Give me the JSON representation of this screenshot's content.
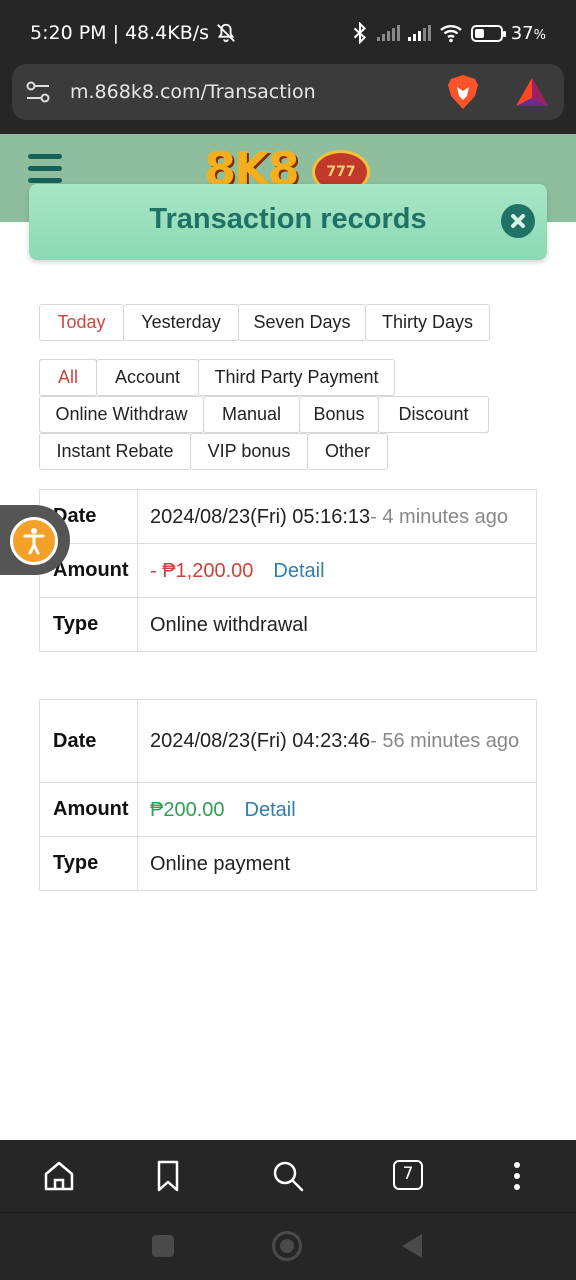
{
  "status_bar": {
    "time": "5:20 PM",
    "separator": "|",
    "speed": "48.4KB/s",
    "battery": "37",
    "battery_unit": "%",
    "battery_level": 0.37
  },
  "browser": {
    "url": "m.868k8.com/Transaction",
    "tab_count": "7"
  },
  "site": {
    "logo_text": "8K8",
    "logo_sub": "777"
  },
  "modal": {
    "title": "Transaction records"
  },
  "period_tabs": [
    {
      "label": "Today",
      "active": true
    },
    {
      "label": "Yesterday",
      "active": false
    },
    {
      "label": "Seven Days",
      "active": false
    },
    {
      "label": "Thirty Days",
      "active": false
    }
  ],
  "type_tabs": [
    {
      "label": "All",
      "active": true
    },
    {
      "label": "Account",
      "active": false
    },
    {
      "label": "Third Party Payment",
      "active": false
    },
    {
      "label": "Online Withdraw",
      "active": false
    },
    {
      "label": "Manual",
      "active": false
    },
    {
      "label": "Bonus",
      "active": false
    },
    {
      "label": "Discount",
      "active": false
    },
    {
      "label": "Instant Rebate",
      "active": false
    },
    {
      "label": "VIP bonus",
      "active": false
    },
    {
      "label": "Other",
      "active": false
    }
  ],
  "labels": {
    "date": "Date",
    "amount": "Amount",
    "type": "Type",
    "detail": "Detail"
  },
  "records": [
    {
      "date": "2024/08/23(Fri) 05:16:13",
      "ago": "- 4 minutes ago",
      "amount": "- ₱1,200.00",
      "type": "Online withdrawal",
      "direction": "negative"
    },
    {
      "date": "2024/08/23(Fri) 04:23:46",
      "ago": "- 56 minutes ago",
      "amount": "₱200.00",
      "type": "Online payment",
      "direction": "positive"
    }
  ],
  "colors": {
    "header_bg": "#8fbe9e",
    "modal_title": "#1f7265",
    "active_tab": "#d2453f",
    "negative": "#c9423c",
    "positive": "#2f9e58",
    "link": "#2f7fb2",
    "accessibility_button": "#f4a12a"
  },
  "icons": {
    "status_left": [
      "do-not-disturb-icon"
    ],
    "status_right": [
      "bluetooth-icon",
      "signal-icon",
      "signal-icon",
      "wifi-icon",
      "battery-icon"
    ],
    "browser": [
      "site-settings-icon",
      "brave-shield-icon",
      "bat-rewards-icon"
    ],
    "bottom_nav": [
      "home-icon",
      "bookmark-icon",
      "search-icon",
      "tabs-icon",
      "more-menu-icon"
    ]
  }
}
